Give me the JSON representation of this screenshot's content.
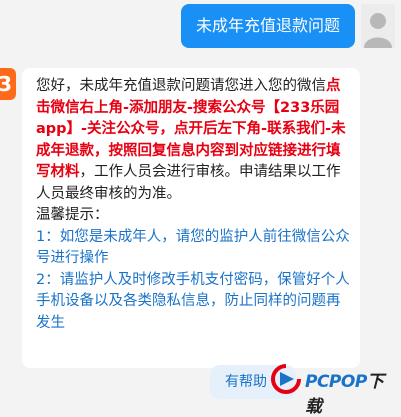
{
  "user_message": "未成年充值退款问题",
  "bot_avatar_text": "3",
  "bot_message": {
    "p1_pre": "您好，未成年充值退款问题请您进入您的微信",
    "p1_red": "点击微信右上角-添加朋友-搜索公众号【233乐园app】-关注公众号，点开后左下角-联系我们-未成年退款，按照回复信息内容到对应链接进行填写材料",
    "p1_post": "，工作人员会进行审核。申请结果以工作人员最终审核的为准。",
    "tips_title": "温馨提示：",
    "tip1": "1：如您是未成年人，请您的监护人前往微信公众号进行操作",
    "tip2": "2：请监护人及时修改手机支付密码，保管好个人手机设备以及各类隐私信息，防止同样的问题再发生"
  },
  "help_button": "有帮助",
  "watermark": {
    "pc": "PCPOP",
    "rest": "下载"
  },
  "colors": {
    "user_bubble": "#1890f5",
    "red_text": "#e60012",
    "blue_text": "#1a73c8",
    "bot_avatar": "#ff6a1a"
  }
}
